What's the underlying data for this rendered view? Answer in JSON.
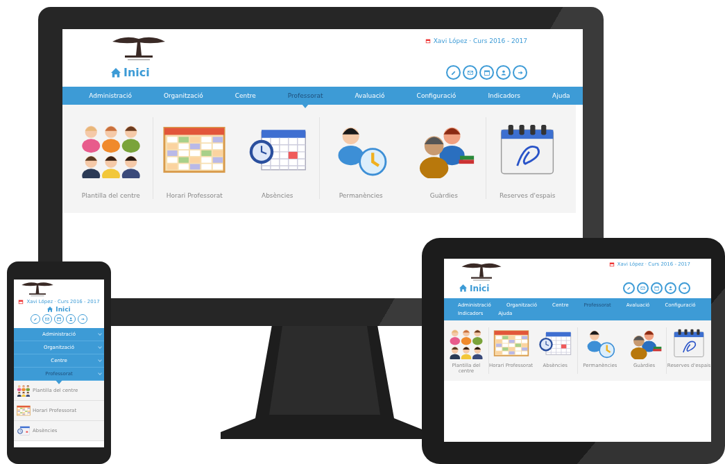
{
  "devices": [
    {
      "kind": "desktop",
      "screen": {
        "user": "Xavi López · Curs 2016 - 2017",
        "title": "Inici",
        "menu": [
          {
            "label": "Administració",
            "selected": false
          },
          {
            "label": "Organització",
            "selected": false
          },
          {
            "label": "Centre",
            "selected": false
          },
          {
            "label": "Professorat",
            "selected": true
          },
          {
            "label": "Avaluació",
            "selected": false
          },
          {
            "label": "Configuració",
            "selected": false
          },
          {
            "label": "Indicadors",
            "selected": false
          },
          {
            "label": "Ajuda",
            "selected": false
          }
        ],
        "items": [
          {
            "label": "Plantilla del centre",
            "kind": "staff"
          },
          {
            "label": "Horari Professorat",
            "kind": "timetable"
          },
          {
            "label": "Absències",
            "kind": "calendar-clock"
          },
          {
            "label": "Permanències",
            "kind": "person-clock"
          },
          {
            "label": "Guàrdies",
            "kind": "people-books"
          },
          {
            "label": "Reserves d'espais",
            "kind": "calendar"
          }
        ]
      }
    },
    {
      "kind": "tablet",
      "screen": {
        "user": "Xavi López · Curs 2016 - 2017",
        "title": "Inici",
        "menu": [
          {
            "label": "Administració",
            "selected": false
          },
          {
            "label": "Organització",
            "selected": false
          },
          {
            "label": "Centre",
            "selected": false
          },
          {
            "label": "Professorat",
            "selected": true
          },
          {
            "label": "Avaluació",
            "selected": false
          },
          {
            "label": "Configuració",
            "selected": false
          },
          {
            "label": "Indicadors",
            "selected": false
          },
          {
            "label": "Ajuda",
            "selected": false
          }
        ],
        "items": [
          {
            "label": "Plantilla del centre",
            "kind": "staff"
          },
          {
            "label": "Horari Professorat",
            "kind": "timetable"
          },
          {
            "label": "Absències",
            "kind": "calendar-clock"
          },
          {
            "label": "Permanències",
            "kind": "person-clock"
          },
          {
            "label": "Guàrdies",
            "kind": "people-books"
          },
          {
            "label": "Reserves d'espais",
            "kind": "calendar"
          }
        ]
      }
    },
    {
      "kind": "phone",
      "screen": {
        "user": "Xavi López · Curs 2016 - 2017",
        "title": "Inici",
        "menu": [
          {
            "label": "Administració",
            "selected": false
          },
          {
            "label": "Organització",
            "selected": false
          },
          {
            "label": "Centre",
            "selected": false
          },
          {
            "label": "Professorat",
            "selected": true
          }
        ],
        "items": [
          {
            "label": "Plantilla del centre",
            "kind": "staff"
          },
          {
            "label": "Horari Professorat",
            "kind": "timetable"
          },
          {
            "label": "Absències",
            "kind": "calendar-clock"
          }
        ]
      }
    }
  ]
}
